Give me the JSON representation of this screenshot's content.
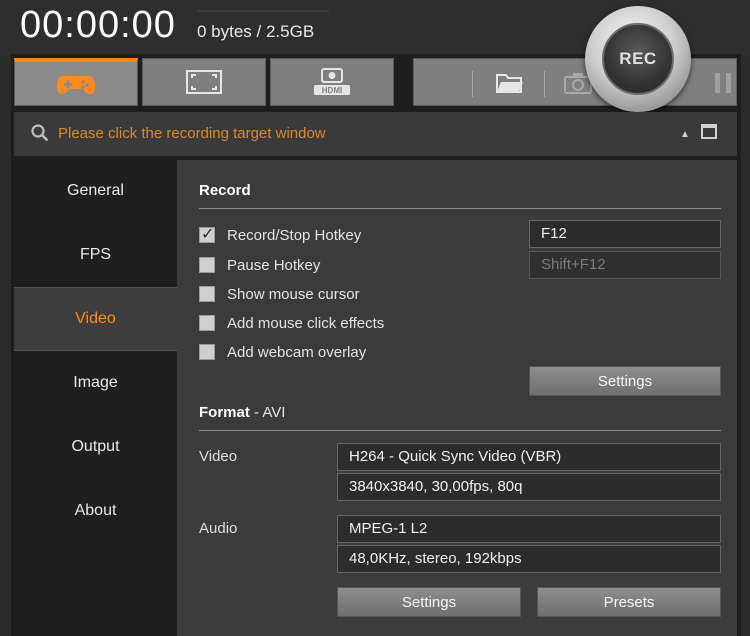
{
  "status": {
    "timer": "00:00:00",
    "size": "0 bytes / 2.5GB"
  },
  "rec_button": {
    "label": "REC"
  },
  "tabs": [
    {
      "icon": "gamepad-icon",
      "active": true
    },
    {
      "icon": "screen-icon",
      "active": false
    },
    {
      "icon": "hdmi-icon",
      "active": false
    }
  ],
  "toolbar_icons": [
    "folder-icon",
    "camera-icon",
    "pause-icon"
  ],
  "search": {
    "placeholder": "Please click the recording target window"
  },
  "sidebar": {
    "items": [
      {
        "label": "General",
        "active": false
      },
      {
        "label": "FPS",
        "active": false
      },
      {
        "label": "Video",
        "active": true
      },
      {
        "label": "Image",
        "active": false
      },
      {
        "label": "Output",
        "active": false
      },
      {
        "label": "About",
        "active": false
      }
    ]
  },
  "record": {
    "title": "Record",
    "options": [
      {
        "label": "Record/Stop Hotkey",
        "checked": true
      },
      {
        "label": "Pause Hotkey",
        "checked": false
      },
      {
        "label": "Show mouse cursor",
        "checked": false
      },
      {
        "label": "Add mouse click effects",
        "checked": false
      },
      {
        "label": "Add webcam overlay",
        "checked": false
      }
    ],
    "record_hotkey": "F12",
    "pause_hotkey": "Shift+F12",
    "settings_label": "Settings"
  },
  "format": {
    "title": "Format",
    "container": "- AVI",
    "video_label": "Video",
    "video_codec": "H264 - Quick Sync Video (VBR)",
    "video_params": "3840x3840, 30,00fps, 80q",
    "audio_label": "Audio",
    "audio_codec": "MPEG-1 L2",
    "audio_params": "48,0KHz, stereo, 192kbps",
    "settings_label": "Settings",
    "presets_label": "Presets"
  },
  "colors": {
    "accent": "#ff8c1a",
    "search_text": "#d8892e",
    "panel": "#3b3b3b",
    "sidebar": "#1f1f1f"
  }
}
